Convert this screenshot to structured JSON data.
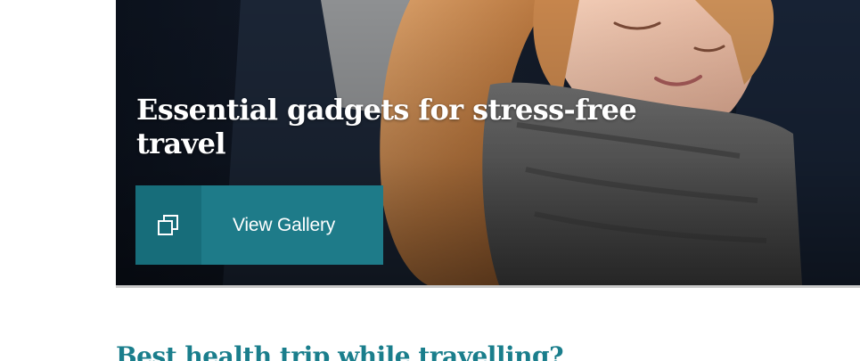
{
  "hero": {
    "title": "Essential gadgets for stress-free travel",
    "image_alt": "Woman sleeping with a travel scarf pillow",
    "gallery_button": {
      "label": "View Gallery",
      "icon": "gallery-icon"
    }
  },
  "next_article": {
    "headline": "Best health trip while travelling?"
  },
  "colors": {
    "accent": "#1e7b89",
    "accent_dark": "#176d7a",
    "headline": "#1a7e8c",
    "hero_border": "#c9c9c9"
  }
}
